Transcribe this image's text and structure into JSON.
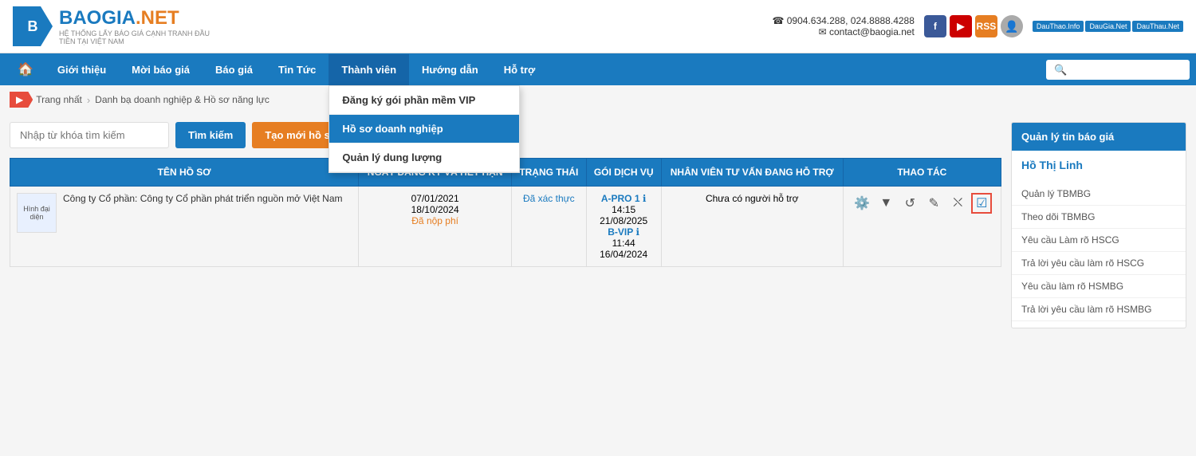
{
  "header": {
    "logo_text_bao": "BAOGIA",
    "logo_text_net": ".NET",
    "logo_subtitle": "HỆ THỐNG LẤY BÁO GIÁ CẠNH TRANH ĐẦU TIÊN TẠI VIỆT NAM",
    "phone": "☎ 0904.634.288, 024.8888.4288",
    "email": "✉ contact@baogia.net",
    "partner_btn1": "DauThao.Info",
    "partner_btn2": "DauGia.Net",
    "partner_btn3": "DauThau.Net"
  },
  "navbar": {
    "home_icon": "🏠",
    "items": [
      {
        "label": "Giới thiệu",
        "active": false
      },
      {
        "label": "Mời báo giá",
        "active": false
      },
      {
        "label": "Báo giá",
        "active": false
      },
      {
        "label": "Tin Tức",
        "active": false
      },
      {
        "label": "Thành viên",
        "active": true
      },
      {
        "label": "Hướng dẫn",
        "active": false
      },
      {
        "label": "Hỗ trợ",
        "active": false
      }
    ],
    "search_placeholder": "🔍"
  },
  "dropdown": {
    "items": [
      {
        "label": "Đăng ký gói phần mềm VIP",
        "selected": false
      },
      {
        "label": "Hồ sơ doanh nghiệp",
        "selected": true
      },
      {
        "label": "Quản lý dung lượng",
        "selected": false
      }
    ]
  },
  "breadcrumb": {
    "items": [
      {
        "label": "Trang nhất"
      },
      {
        "label": "Danh bạ doanh nghiệp & Hồ sơ năng lực"
      }
    ]
  },
  "search_bar": {
    "placeholder": "Nhập từ khóa tìm kiếm",
    "btn_search": "Tìm kiếm",
    "btn_create": "Tạo mới hồ sơ"
  },
  "table": {
    "headers": [
      "TÊN HỒ SƠ",
      "NGÀY ĐĂNG KÝ VÀ HẾT HẠN",
      "TRẠNG THÁI",
      "GÓI DỊCH VỤ",
      "NHÂN VIÊN TƯ VẤN ĐANG HỖ TRỢ",
      "THAO TÁC"
    ],
    "rows": [
      {
        "logo_text": "Hình đại diện",
        "company_name": "Công ty Cổ phần: Công ty Cổ phần phát triển nguồn mở Việt Nam",
        "date_register": "07/01/2021",
        "date_expire": "18/10/2024",
        "date_note": "Đã nộp phí",
        "status": "Đã xác thực",
        "service_name": "A-PRO 1",
        "service_time1": "14:15",
        "service_date1": "21/08/2025",
        "service_name2": "B-VIP",
        "service_time2": "11:44",
        "service_date2": "16/04/2024",
        "consultant": "Chưa có người hỗ trợ",
        "actions": [
          "⚙",
          "▼",
          "↺",
          "✎",
          "⛌",
          "☑"
        ]
      }
    ]
  },
  "sidebar": {
    "title": "Quản lý tin báo giá",
    "username": "Hồ Thị Linh",
    "links": [
      "Quản lý TBMBG",
      "Theo dõi TBMBG",
      "Yêu cầu Làm rõ HSCG",
      "Trả lời yêu cầu làm rõ HSCG",
      "Yêu cầu làm rõ HSMBG",
      "Trả lời yêu cầu làm rõ HSMBG"
    ]
  }
}
